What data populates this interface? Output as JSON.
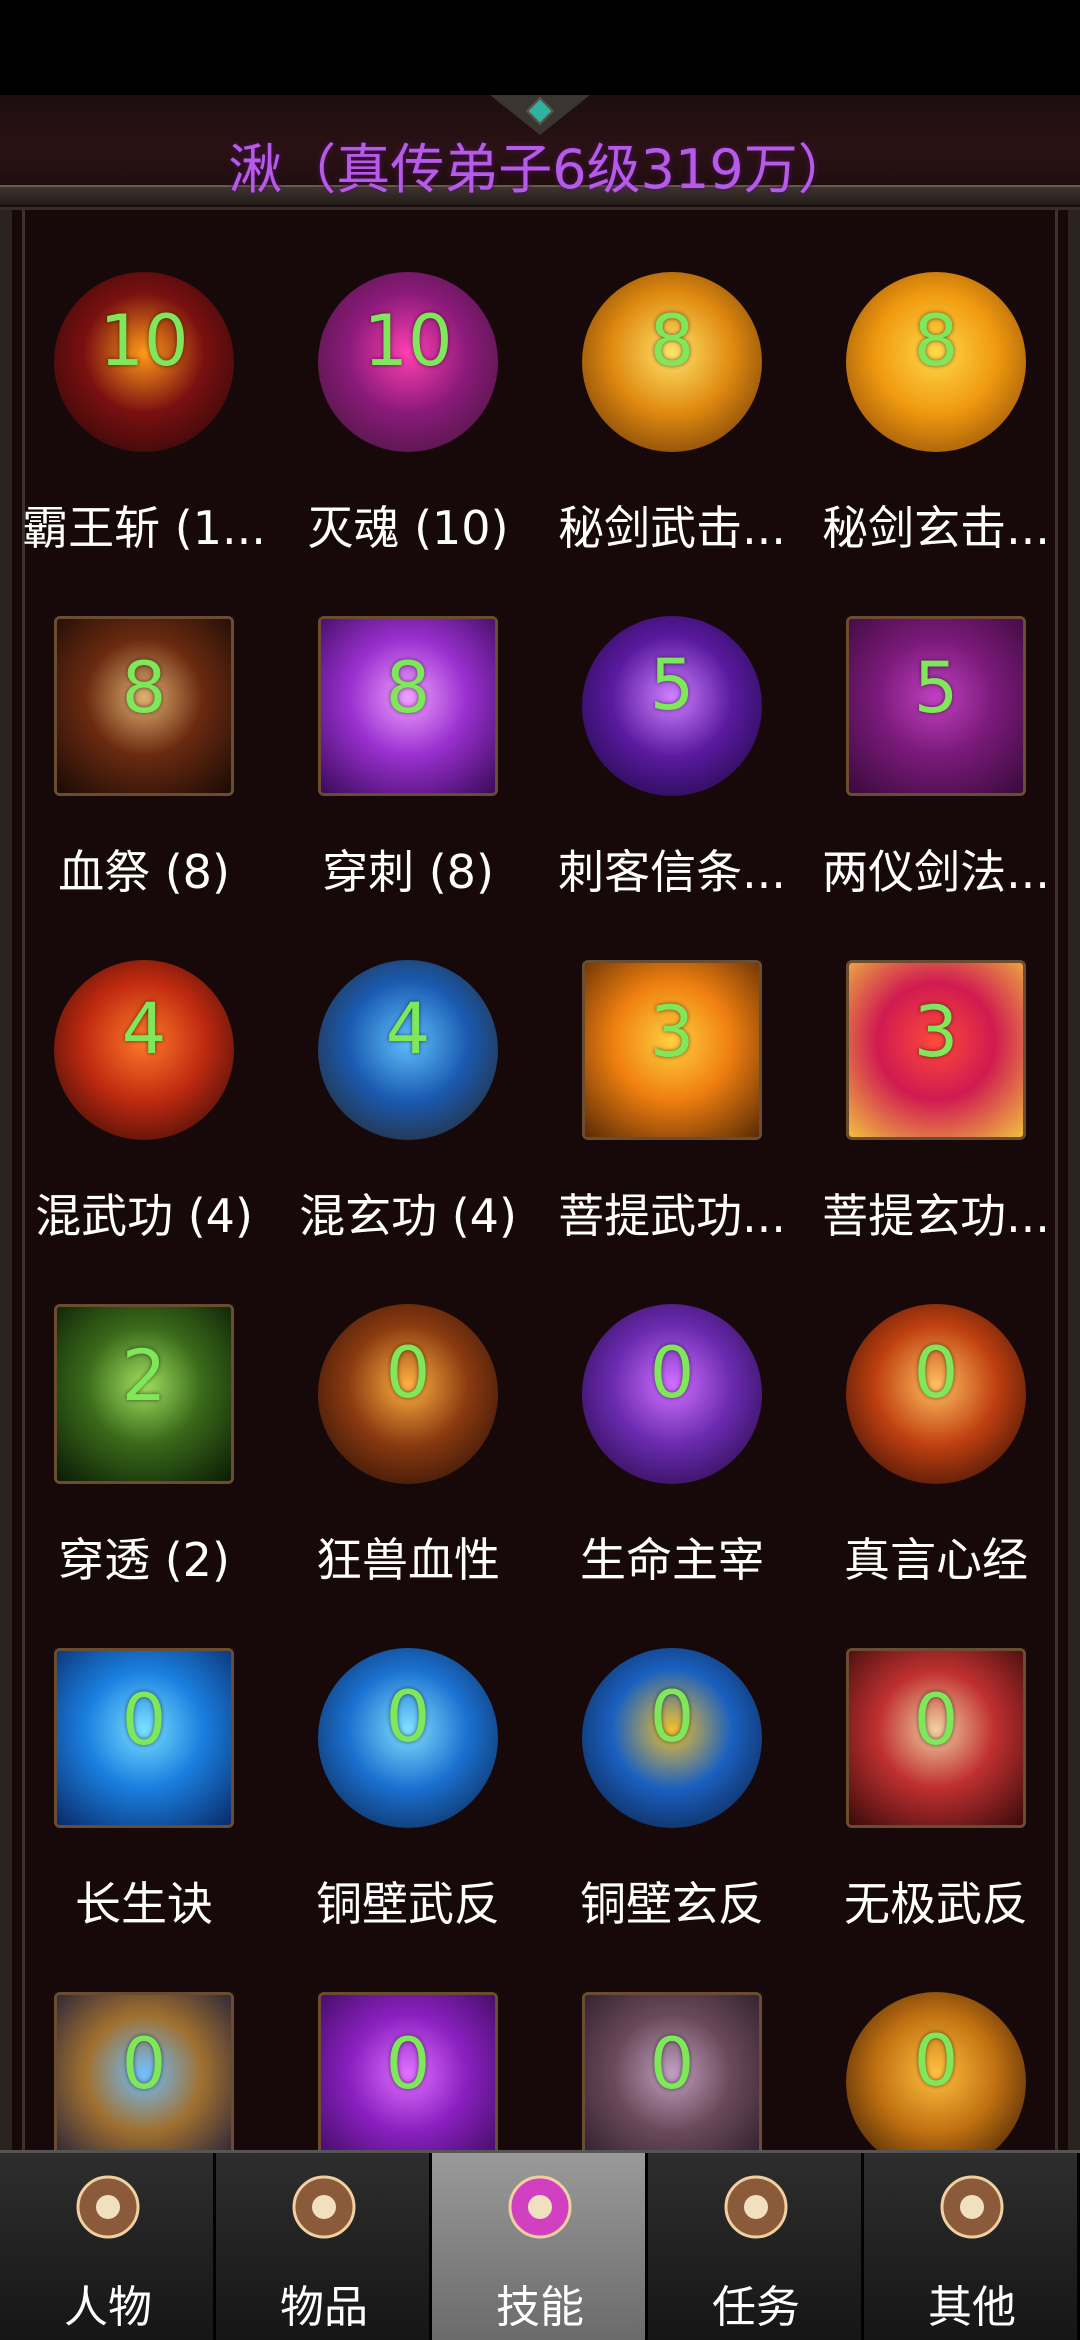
{
  "header": {
    "title": "湫（真传弟子6级319万）"
  },
  "skills": [
    {
      "name": "霸王斩 (1...",
      "level": "10",
      "icon": "fire-slash-icon",
      "shape": "round",
      "colors": [
        "#ff9a1a",
        "#7a1010",
        "#1a0606"
      ]
    },
    {
      "name": "灭魂 (10)",
      "level": "10",
      "icon": "magenta-gem-crest-icon",
      "shape": "round",
      "colors": [
        "#ff3fb0",
        "#8a1a7a",
        "#3a1530"
      ]
    },
    {
      "name": "秘剑武击...",
      "level": "8",
      "icon": "golden-vortex-icon",
      "shape": "round",
      "colors": [
        "#ffe36a",
        "#e08a10",
        "#5a2a05"
      ]
    },
    {
      "name": "秘剑玄击...",
      "level": "8",
      "icon": "golden-fists-icon",
      "shape": "round",
      "colors": [
        "#ffd84a",
        "#f09a10",
        "#7a3a05"
      ]
    },
    {
      "name": "血祭 (8)",
      "level": "8",
      "icon": "winged-figure-icon",
      "shape": "square",
      "colors": [
        "#e0b070",
        "#6a2a10",
        "#1a0a05"
      ]
    },
    {
      "name": "穿刺 (8)",
      "level": "8",
      "icon": "purple-portal-icon",
      "shape": "square",
      "colors": [
        "#f0a0ff",
        "#9a30d0",
        "#3a0a5a"
      ]
    },
    {
      "name": "刺客信条...",
      "level": "5",
      "icon": "violet-sword-icon",
      "shape": "round",
      "colors": [
        "#d080ff",
        "#5a1aa0",
        "#140530"
      ]
    },
    {
      "name": "两仪剑法...",
      "level": "5",
      "icon": "crossed-swords-icon",
      "shape": "square",
      "colors": [
        "#c040c0",
        "#7a1a7a",
        "#3a0a3a"
      ]
    },
    {
      "name": "混武功 (4)",
      "level": "4",
      "icon": "red-potion-icon",
      "shape": "round",
      "colors": [
        "#ff7a2a",
        "#c02a10",
        "#1a0505"
      ]
    },
    {
      "name": "混玄功 (4)",
      "level": "4",
      "icon": "blue-gem-crest-icon",
      "shape": "round",
      "colors": [
        "#60c0ff",
        "#1a5ab0",
        "#2a2010"
      ]
    },
    {
      "name": "菩提武功...",
      "level": "3",
      "icon": "eye-icon",
      "shape": "square",
      "colors": [
        "#ffd040",
        "#f08010",
        "#5a2a05"
      ]
    },
    {
      "name": "菩提玄功...",
      "level": "3",
      "icon": "red-orb-icon",
      "shape": "square",
      "colors": [
        "#ff4a3a",
        "#d01a50",
        "#f0c040"
      ]
    },
    {
      "name": "穿透 (2)",
      "level": "2",
      "icon": "skull-icon",
      "shape": "square",
      "colors": [
        "#a0e060",
        "#3a6a1a",
        "#0a1a05"
      ]
    },
    {
      "name": "狂兽血性",
      "level": "0",
      "icon": "beast-claw-icon",
      "shape": "round",
      "colors": [
        "#ffb040",
        "#8a3a10",
        "#1a0805"
      ]
    },
    {
      "name": "生命主宰",
      "level": "0",
      "icon": "purple-warrior-icon",
      "shape": "round",
      "colors": [
        "#d070ff",
        "#6a2ab0",
        "#1a0530"
      ]
    },
    {
      "name": "真言心经",
      "level": "0",
      "icon": "fire-ring-icon",
      "shape": "round",
      "colors": [
        "#ffc060",
        "#c04010",
        "#1a0505"
      ]
    },
    {
      "name": "长生诀",
      "level": "0",
      "icon": "blue-silhouette-icon",
      "shape": "square",
      "colors": [
        "#7ae0ff",
        "#1a80e0",
        "#0a2a6a"
      ]
    },
    {
      "name": "铜壁武反",
      "level": "0",
      "icon": "blue-swirl-icon",
      "shape": "round",
      "colors": [
        "#80e0ff",
        "#1a70d0",
        "#0a1a3a"
      ]
    },
    {
      "name": "铜壁玄反",
      "level": "0",
      "icon": "blue-gold-swirl-icon",
      "shape": "round",
      "colors": [
        "#f0c030",
        "#1a60c0",
        "#0a1530"
      ]
    },
    {
      "name": "无极武反",
      "level": "0",
      "icon": "ornate-cross-icon",
      "shape": "square",
      "colors": [
        "#f0d0a0",
        "#c03030",
        "#3a0a0a"
      ]
    },
    {
      "name": "",
      "level": "0",
      "icon": "armored-knight-icon",
      "shape": "square",
      "colors": [
        "#70c0ff",
        "#a07030",
        "#1a1a3a"
      ]
    },
    {
      "name": "",
      "level": "0",
      "icon": "purple-brain-icon",
      "shape": "square",
      "colors": [
        "#e070ff",
        "#8a20c0",
        "#3a0a5a"
      ]
    },
    {
      "name": "",
      "level": "0",
      "icon": "helmet-icon",
      "shape": "square",
      "colors": [
        "#c0a0c0",
        "#6a4a5a",
        "#2a1a2a"
      ]
    },
    {
      "name": "",
      "level": "0",
      "icon": "gold-flask-icon",
      "shape": "round",
      "colors": [
        "#ffc040",
        "#c07010",
        "#1a0a05"
      ]
    }
  ],
  "tabs": [
    {
      "label": "人物",
      "icon": "character-icon",
      "active": false
    },
    {
      "label": "物品",
      "icon": "potion-icon",
      "active": false
    },
    {
      "label": "技能",
      "icon": "skill-orb-icon",
      "active": true
    },
    {
      "label": "任务",
      "icon": "quest-book-icon",
      "active": false
    },
    {
      "label": "其他",
      "icon": "settings-sword-icon",
      "active": false
    }
  ]
}
